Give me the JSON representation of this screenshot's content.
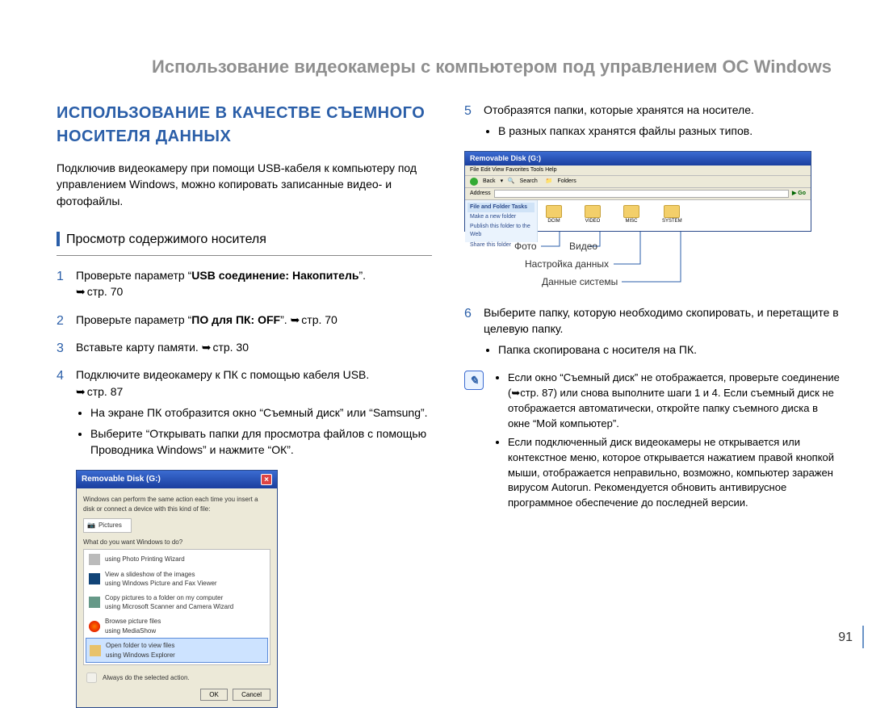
{
  "header": {
    "title": "Использование видеокамеры с компьютером под управлением ОС Windows"
  },
  "section": {
    "title": "ИСПОЛЬЗОВАНИЕ В КАЧЕСТВЕ СЪЕМНОГО НОСИТЕЛЯ ДАННЫХ"
  },
  "intro": "Подключив видеокамеру при помощи USB-кабеля к компьютеру под управлением Windows, можно копировать записанные видео- и фотофайлы.",
  "subhead": "Просмотр содержимого носителя",
  "steps_left": [
    {
      "n": "1",
      "text_a": "Проверьте параметр “",
      "text_bold": "USB соединение: Накопитель",
      "text_b": "”. ",
      "ref": "стр. 70"
    },
    {
      "n": "2",
      "text_a": "Проверьте параметр “",
      "text_bold": "ПО для ПК: OFF",
      "text_b": "”. ",
      "ref": "стр. 70",
      "inline_ref": true
    },
    {
      "n": "3",
      "text_a": "Вставьте карту памяти. ",
      "ref": "стр. 30",
      "inline_ref": true
    },
    {
      "n": "4",
      "text_a": "Подключите видеокамеру к ПК с помощью кабеля USB. ",
      "ref": "стр. 87",
      "bullets": [
        "На экране ПК отобразится окно “Съемный диск” или “Samsung”.",
        "Выберите “Открывать папки для просмотра файлов с помощью Проводника Windows” и нажмите “ОК”."
      ]
    }
  ],
  "steps_right": [
    {
      "n": "5",
      "text_a": "Отобразятся папки, которые хранятся на носителе.",
      "bullets": [
        "В разных папках хранятся файлы разных типов."
      ]
    },
    {
      "n": "6",
      "text_a": "Выберите папку, которую необходимо скопировать, и перетащите в целевую папку.",
      "bullets": [
        "Папка скопирована с носителя на ПК."
      ]
    }
  ],
  "autoplay": {
    "title": "Removable Disk (G:)",
    "hint": "Windows can perform the same action each time you insert a disk or connect a device with this kind of file:",
    "pictures": "Pictures",
    "prompt": "What do you want Windows to do?",
    "opts": {
      "printer1": "using Photo Printing Wizard",
      "slideshow1": "View a slideshow of the images",
      "slideshow2": "using Windows Picture and Fax Viewer",
      "copy1": "Copy pictures to a folder on my computer",
      "copy2": "using Microsoft Scanner and Camera Wizard",
      "browse1": "Browse picture files",
      "browse2": "using MediaShow",
      "open1": "Open folder to view files",
      "open2": "using Windows Explorer"
    },
    "always": "Always do the selected action.",
    "ok": "OK",
    "cancel": "Cancel"
  },
  "explorer": {
    "title": "Removable Disk (G:)",
    "menu": "File   Edit   View   Favorites   Tools   Help",
    "toolbar": {
      "back": "Back",
      "search": "Search",
      "folders": "Folders"
    },
    "addr_label": "Address",
    "go": "Go",
    "side_header": "File and Folder Tasks",
    "side_links": [
      "Make a new folder",
      "Publish this folder to the Web",
      "Share this folder"
    ],
    "folders": [
      "DCIM",
      "VIDEO",
      "MISC",
      "SYSTEM"
    ]
  },
  "callouts": {
    "photo": "Фото",
    "video": "Видео",
    "settings": "Настройка данных",
    "system": "Данные системы"
  },
  "notes": [
    "Если окно “Съемный диск” не отображается, проверьте соединение (➥стр. 87) или снова выполните шаги 1 и 4. Если съемный диск не отображается автоматически, откройте папку съемного диска в окне “Мой компьютер”.",
    "Если подключенный диск видеокамеры не открывается или контекстное меню, которое открывается нажатием правой кнопкой мыши, отображается неправильно, возможно, компьютер заражен вирусом Autorun. Рекомендуется обновить антивирусное программное обеспечение до последней версии."
  ],
  "page_number": "91"
}
